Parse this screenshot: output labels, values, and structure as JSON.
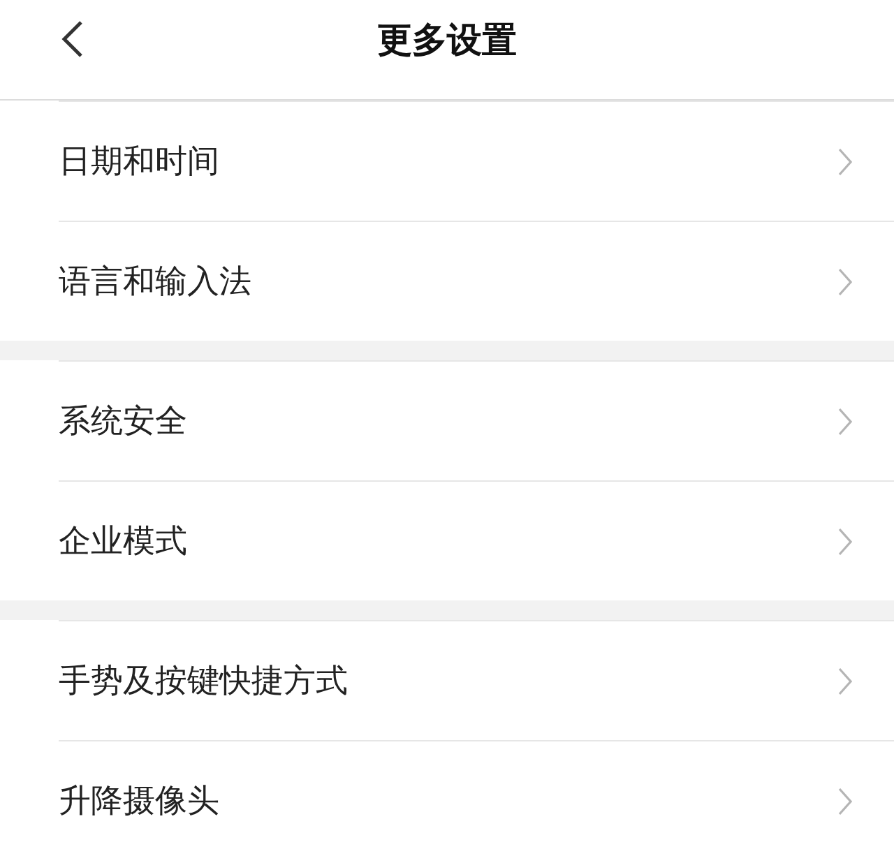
{
  "header": {
    "title": "更多设置"
  },
  "groups": [
    {
      "items": [
        {
          "label": "日期和时间"
        },
        {
          "label": "语言和输入法"
        }
      ]
    },
    {
      "items": [
        {
          "label": "系统安全"
        },
        {
          "label": "企业模式"
        }
      ]
    },
    {
      "items": [
        {
          "label": "手势及按键快捷方式"
        },
        {
          "label": "升降摄像头"
        }
      ]
    }
  ]
}
